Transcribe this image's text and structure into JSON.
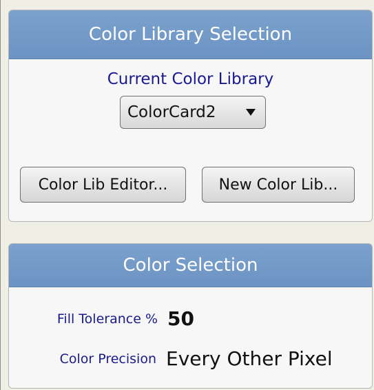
{
  "color_library_panel": {
    "title": "Color Library Selection",
    "current_label": "Current Color Library",
    "current_library": "ColorCard2",
    "editor_button": "Color Lib Editor...",
    "new_button": "New Color Lib..."
  },
  "color_selection_panel": {
    "title": "Color Selection",
    "fill_tolerance_label": "Fill Tolerance %",
    "fill_tolerance_value": "50",
    "precision_label": "Color Precision",
    "precision_value": "Every Other Pixel"
  }
}
